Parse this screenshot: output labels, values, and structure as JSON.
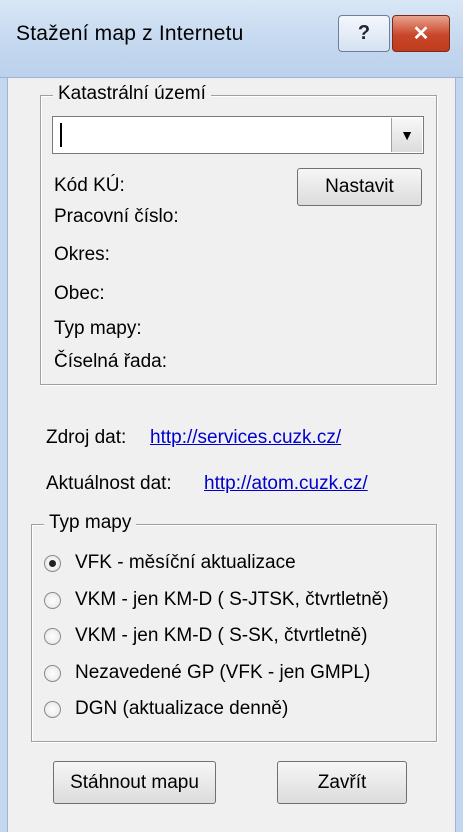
{
  "window": {
    "title": "Stažení map z Internetu",
    "help_label": "?",
    "close_label": "✕"
  },
  "cadastral": {
    "legend": "Katastrální území",
    "combo_value": "",
    "combo_arrow": "▼",
    "set_button": "Nastavit",
    "fields": {
      "kod": "Kód KÚ:",
      "pracovni": "Pracovní číslo:",
      "okres": "Okres:",
      "obec": "Obec:",
      "typ": "Typ mapy:",
      "rada": "Číselná řada:"
    }
  },
  "sources": {
    "zdroj_label": "Zdroj dat:",
    "zdroj_link": "http://services.cuzk.cz/",
    "aktualnost_label": "Aktuálnost dat:",
    "aktualnost_link": "http://atom.cuzk.cz/"
  },
  "map_type": {
    "legend": "Typ mapy",
    "options": [
      {
        "label": "VFK - měsíční aktualizace",
        "checked": true
      },
      {
        "label": "VKM - jen KM-D ( S-JTSK, čtvrtletně)",
        "checked": false
      },
      {
        "label": "VKM - jen KM-D ( S-SK, čtvrtletně)",
        "checked": false
      },
      {
        "label": "Nezavedené GP (VFK - jen GMPL)",
        "checked": false
      },
      {
        "label": "DGN (aktualizace denně)",
        "checked": false
      }
    ]
  },
  "actions": {
    "download": "Stáhnout mapu",
    "close": "Zavřít"
  }
}
